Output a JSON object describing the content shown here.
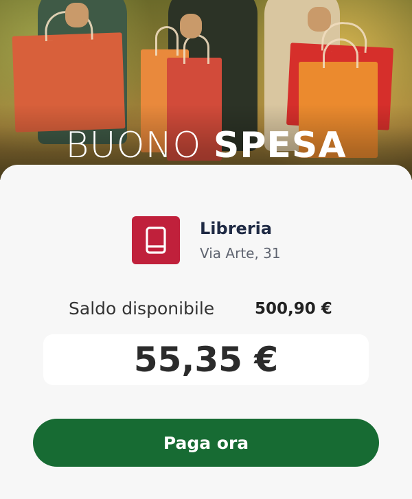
{
  "banner": {
    "title_light": "BUONO",
    "title_bold": "SPESA"
  },
  "merchant": {
    "icon": "book-icon",
    "icon_color": "#c0203b",
    "name": "Libreria",
    "address": "Via Arte, 31"
  },
  "balance": {
    "label": "Saldo disponibile",
    "value": "500,90 €"
  },
  "amount": {
    "value": "55,35 €"
  },
  "actions": {
    "pay_label": "Paga ora",
    "pay_color": "#176b33"
  }
}
